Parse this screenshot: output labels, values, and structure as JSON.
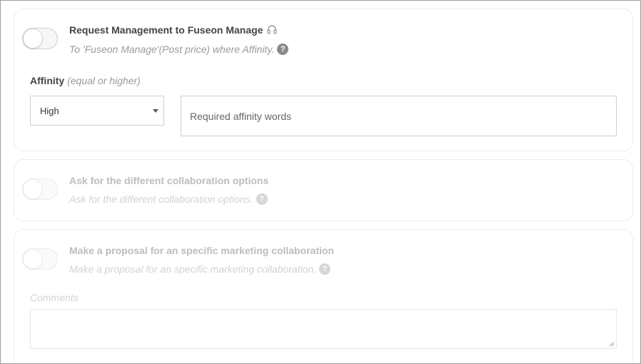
{
  "request_management": {
    "title": "Request Management to Fuseon Manage",
    "subtitle": "To 'Fuseon Manage'(Post price) where Affinity.",
    "help_glyph": "?",
    "icon": "headset-icon",
    "enabled": false
  },
  "affinity": {
    "label": "Affinity",
    "hint": "(equal or higher)",
    "selected": "High",
    "words_placeholder": "Required affinity words"
  },
  "collaboration_options": {
    "title": "Ask for the different collaboration options",
    "subtitle": "Ask for the different collaboration options.",
    "help_glyph": "?",
    "enabled": false
  },
  "marketing_proposal": {
    "title": "Make a proposal for an specific marketing collaboration",
    "subtitle": "Make a proposal for an specific marketing collaboration.",
    "help_glyph": "?",
    "comments_label": "Comments",
    "enabled": false
  },
  "colors": {
    "text_dark": "#444444",
    "text_muted": "#9a9a9a",
    "text_disabled": "#bdbdbd",
    "border": "#cfcfcf"
  }
}
